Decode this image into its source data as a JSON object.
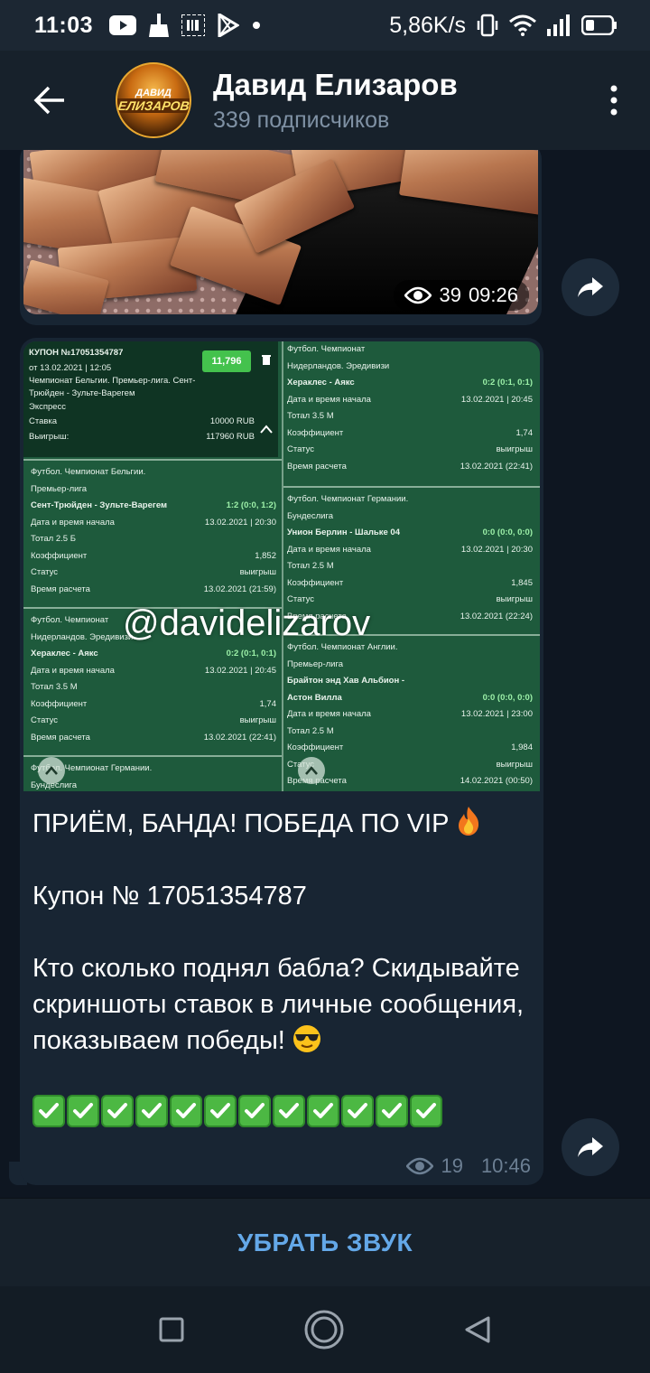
{
  "status_bar": {
    "time": "11:03",
    "network_speed": "5,86K/s",
    "icons": [
      "youtube-icon",
      "broom-icon",
      "barcode-icon",
      "play-store-icon",
      "dot-icon",
      "vibrate-icon",
      "wifi-icon",
      "signal-icon",
      "battery-icon"
    ]
  },
  "header": {
    "back_icon": "arrow-left-icon",
    "channel_name": "Давид Елизаров",
    "subscribers": "339 подписчиков",
    "avatar_text_1": "ДАВИД",
    "avatar_text_2": "ЕЛИЗАРОВ",
    "menu_icon": "more-vertical-icon"
  },
  "messages": [
    {
      "type": "photo",
      "views": "39",
      "time": "09:26"
    },
    {
      "type": "photo_with_caption",
      "coupon": {
        "header": {
          "number": "КУПОН №17051354787",
          "date": "от 13.02.2021 | 12:05",
          "win_badge": "11,796",
          "events_line1": "Чемпионат Бельгии. Премьер-лига. Сент-",
          "events_line2": "Трюйден - Зульте-Варегем",
          "bet_type": "Экспресс",
          "stake_label": "Ставка",
          "stake_value": "10000 RUB",
          "winnings_label": "Выигрыш:",
          "winnings_value": "117960 RUB"
        },
        "left_blocks": [
          {
            "sport": "Футбол. Чемпионат Бельгии.",
            "league": "Премьер-лига",
            "match": "Сент-Трюйден - Зульте-Варегем",
            "score": "1:2 (0:0, 1:2)",
            "start_label": "Дата и время начала",
            "start_value": "13.02.2021 | 20:30",
            "market": "Тотал 2.5 Б",
            "coef_label": "Коэффициент",
            "coef_value": "1,852",
            "status_label": "Статус",
            "status_value": "выигрыш",
            "calc_label": "Время расчета",
            "calc_value": "13.02.2021 (21:59)"
          },
          {
            "sport": "Футбол. Чемпионат",
            "league": "Нидерландов. Эредивизи",
            "match": "Хераклес - Аякс",
            "score": "0:2 (0:1, 0:1)",
            "start_label": "Дата и время начала",
            "start_value": "13.02.2021 | 20:45",
            "market": "Тотал 3.5 М",
            "coef_label": "Коэффициент",
            "coef_value": "1,74",
            "status_label": "Статус",
            "status_value": "выигрыш",
            "calc_label": "Время расчета",
            "calc_value": "13.02.2021 (22:41)"
          }
        ],
        "left_footer": {
          "sport": "Футбол. Чемпионат Германии.",
          "league": "Бундеслига"
        },
        "right_blocks": [
          {
            "sport": "Футбол. Чемпионат",
            "league": "Нидерландов. Эредивизи",
            "match": "Хераклес - Аякс",
            "score": "0:2 (0:1, 0:1)",
            "start_label": "Дата и время начала",
            "start_value": "13.02.2021 | 20:45",
            "market": "Тотал 3.5 М",
            "coef_label": "Коэффициент",
            "coef_value": "1,74",
            "status_label": "Статус",
            "status_value": "выигрыш",
            "calc_label": "Время расчета",
            "calc_value": "13.02.2021 (22:41)"
          },
          {
            "sport": "Футбол. Чемпионат Германии.",
            "league": "Бундеслига",
            "match": "Унион Берлин - Шальке 04",
            "score": "0:0 (0:0, 0:0)",
            "start_label": "Дата и время начала",
            "start_value": "13.02.2021 | 20:30",
            "market": "Тотал 2.5 М",
            "coef_label": "Коэффициент",
            "coef_value": "1,845",
            "status_label": "Статус",
            "status_value": "выигрыш",
            "calc_label": "Время расчета",
            "calc_value": "13.02.2021 (22:24)"
          },
          {
            "sport": "Футбол. Чемпионат Англии.",
            "league": "Премьер-лига",
            "match": "Брайтон энд Хав Альбион -",
            "match2": "Астон Вилла",
            "score": "0:0 (0:0, 0:0)",
            "start_label": "Дата и время начала",
            "start_value": "13.02.2021 | 23:00",
            "market": "Тотал 2.5 М",
            "coef_label": "Коэффициент",
            "coef_value": "1,984",
            "status_label": "Статус",
            "status_value": "выигрыш",
            "calc_label": "Время расчета",
            "calc_value": "14.02.2021 (00:50)"
          }
        ],
        "watermark": "@davidelizarov"
      },
      "text": {
        "line1": "ПРИЁМ, БАНДА! ПОБЕДА ПО VIP",
        "line2": "Купон № 17051354787",
        "line3": "Кто сколько поднял бабла? Скидывайте скриншоты ставок в личные сообщения, показываем победы!"
      },
      "check_count": 12,
      "views": "19",
      "time": "10:46"
    }
  ],
  "mute_bar": {
    "label": "УБРАТЬ ЗВУК"
  },
  "nav_bar": {
    "icons": [
      "recent-apps-icon",
      "home-icon",
      "back-triangle-icon"
    ]
  },
  "colors": {
    "background": "#0e1621",
    "header": "#17212b",
    "bubble": "#182533",
    "accent": "#64a8e8",
    "muted_text": "#7f91a4"
  }
}
